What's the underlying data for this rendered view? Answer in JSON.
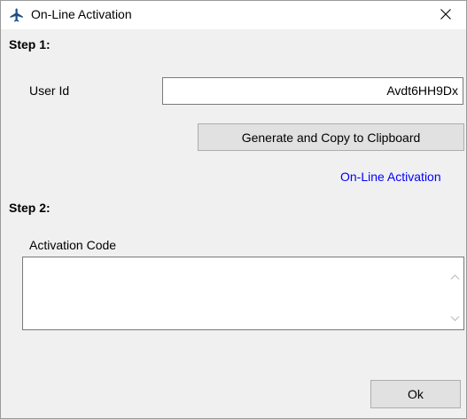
{
  "window": {
    "title": "On-Line Activation",
    "app_icon": "airplane-icon",
    "close_icon": "close-icon"
  },
  "step1": {
    "heading": "Step 1:",
    "user_id_label": "User Id",
    "user_id_value": "Avdt6HH9Dx",
    "generate_button": "Generate and Copy to Clipboard",
    "online_link": "On-Line Activation"
  },
  "step2": {
    "heading": "Step 2:",
    "activation_code_label": "Activation Code",
    "activation_code_value": ""
  },
  "footer": {
    "ok_button": "Ok"
  },
  "colors": {
    "link": "#0000ff",
    "window_bg": "#f0f0f0",
    "button_bg": "#e1e1e1"
  }
}
